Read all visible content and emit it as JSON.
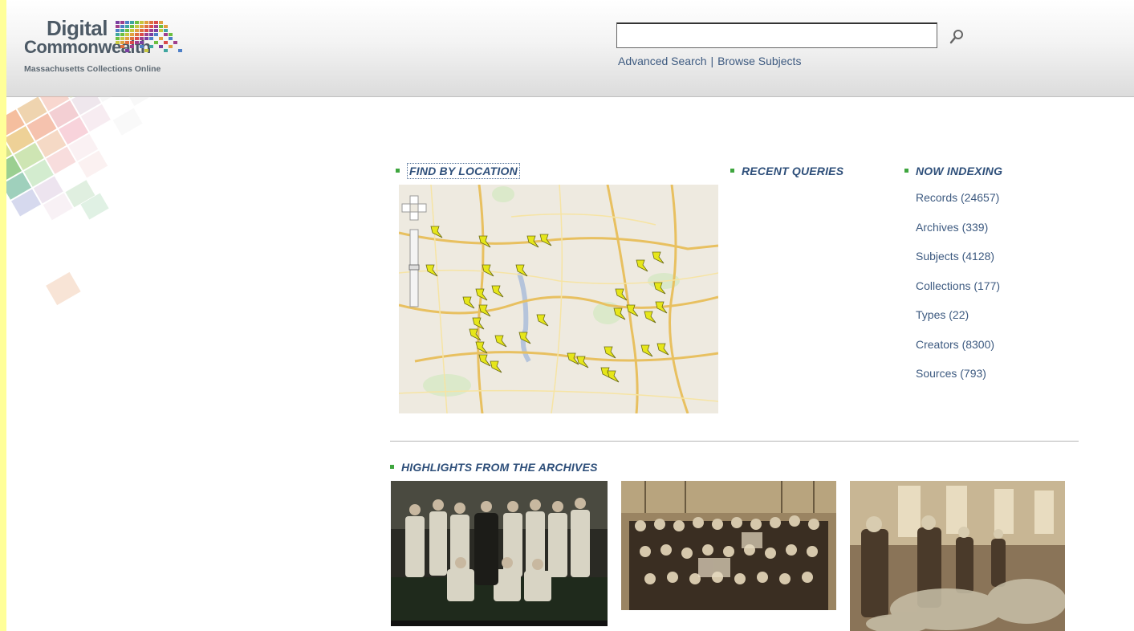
{
  "logo": {
    "line1": "Digital",
    "line2": "Commonwealth",
    "line3": "Massachusetts Collections Online"
  },
  "search": {
    "value": "",
    "placeholder": "",
    "advanced_label": "Advanced Search",
    "separator": "|",
    "browse_label": "Browse Subjects",
    "button_icon": "search-icon"
  },
  "sections": {
    "find_by_location": "FIND BY LOCATION",
    "recent_queries": "RECENT QUERIES",
    "now_indexing": "NOW INDEXING",
    "highlights": "HIGHLIGHTS FROM THE ARCHIVES"
  },
  "now_indexing": [
    "Records (24657)",
    "Archives (339)",
    "Subjects (4128)",
    "Collections (177)",
    "Types (22)",
    "Creators (8300)",
    "Sources (793)"
  ],
  "colors": {
    "link": "#3d5a80",
    "section_title": "#2e4f7a",
    "bullet": "#3fa63f",
    "page_border": "#ffff99"
  }
}
